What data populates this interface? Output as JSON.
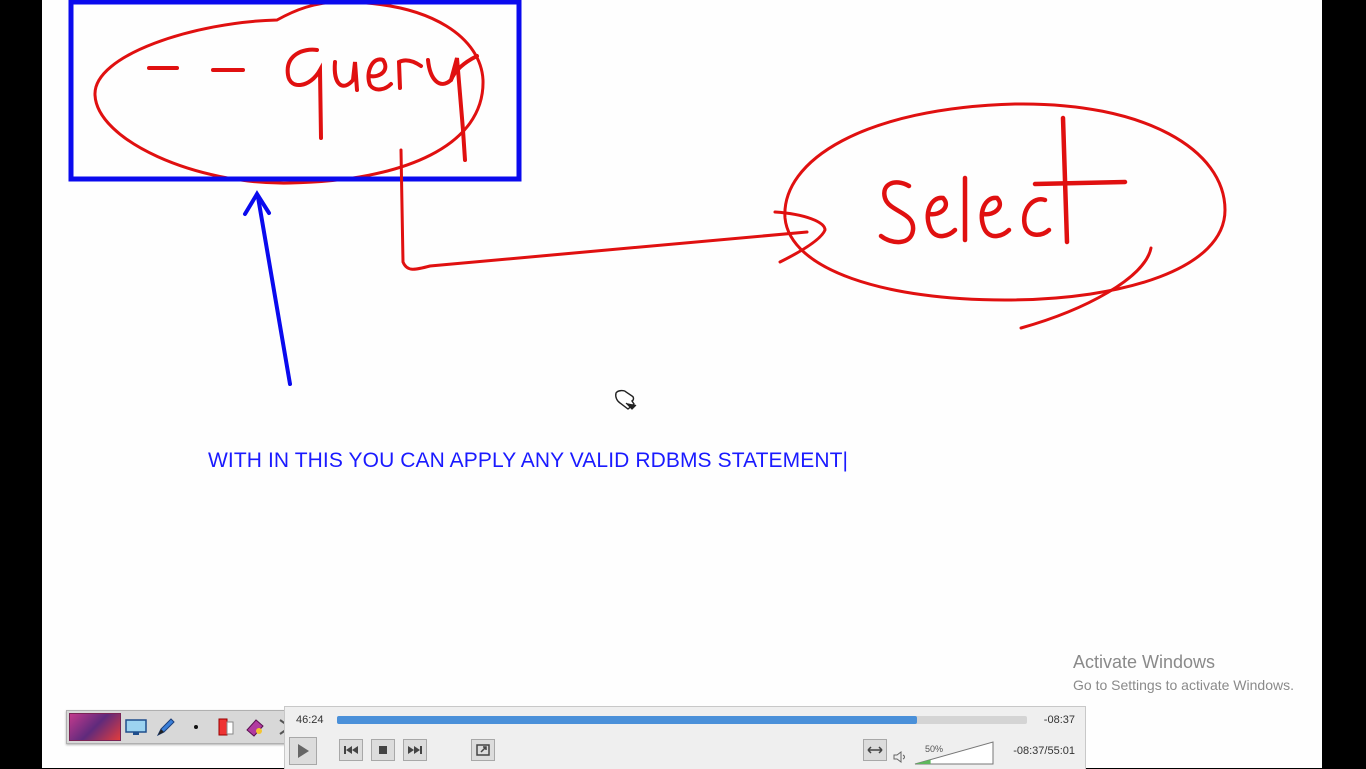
{
  "annotation": {
    "handwritten_word_left": "- - query",
    "handwritten_word_right": "Select",
    "typed_text": "WITH IN THIS YOU CAN APPLY ANY VALID RDBMS STATEMENT|"
  },
  "watermark": {
    "title": "Activate Windows",
    "subtitle": "Go to Settings to activate Windows."
  },
  "pen_toolbar": {
    "items": [
      "logo",
      "screen-icon",
      "pen-icon",
      "dot-icon",
      "highlighter-icon",
      "eraser-icon",
      "arrow-icon"
    ]
  },
  "player": {
    "elapsed": "46:24",
    "remaining": "-08:37",
    "progress_fraction": 0.84,
    "volume_label": "50%",
    "volume_fraction": 0.5,
    "duration_label": "-08:37/55:01"
  },
  "colors": {
    "ink_red": "#e01010",
    "ink_blue": "#0a0aee",
    "text_blue": "#1a1aff",
    "seek_blue": "#4a90d9",
    "volume_green": "#5cb85c"
  }
}
